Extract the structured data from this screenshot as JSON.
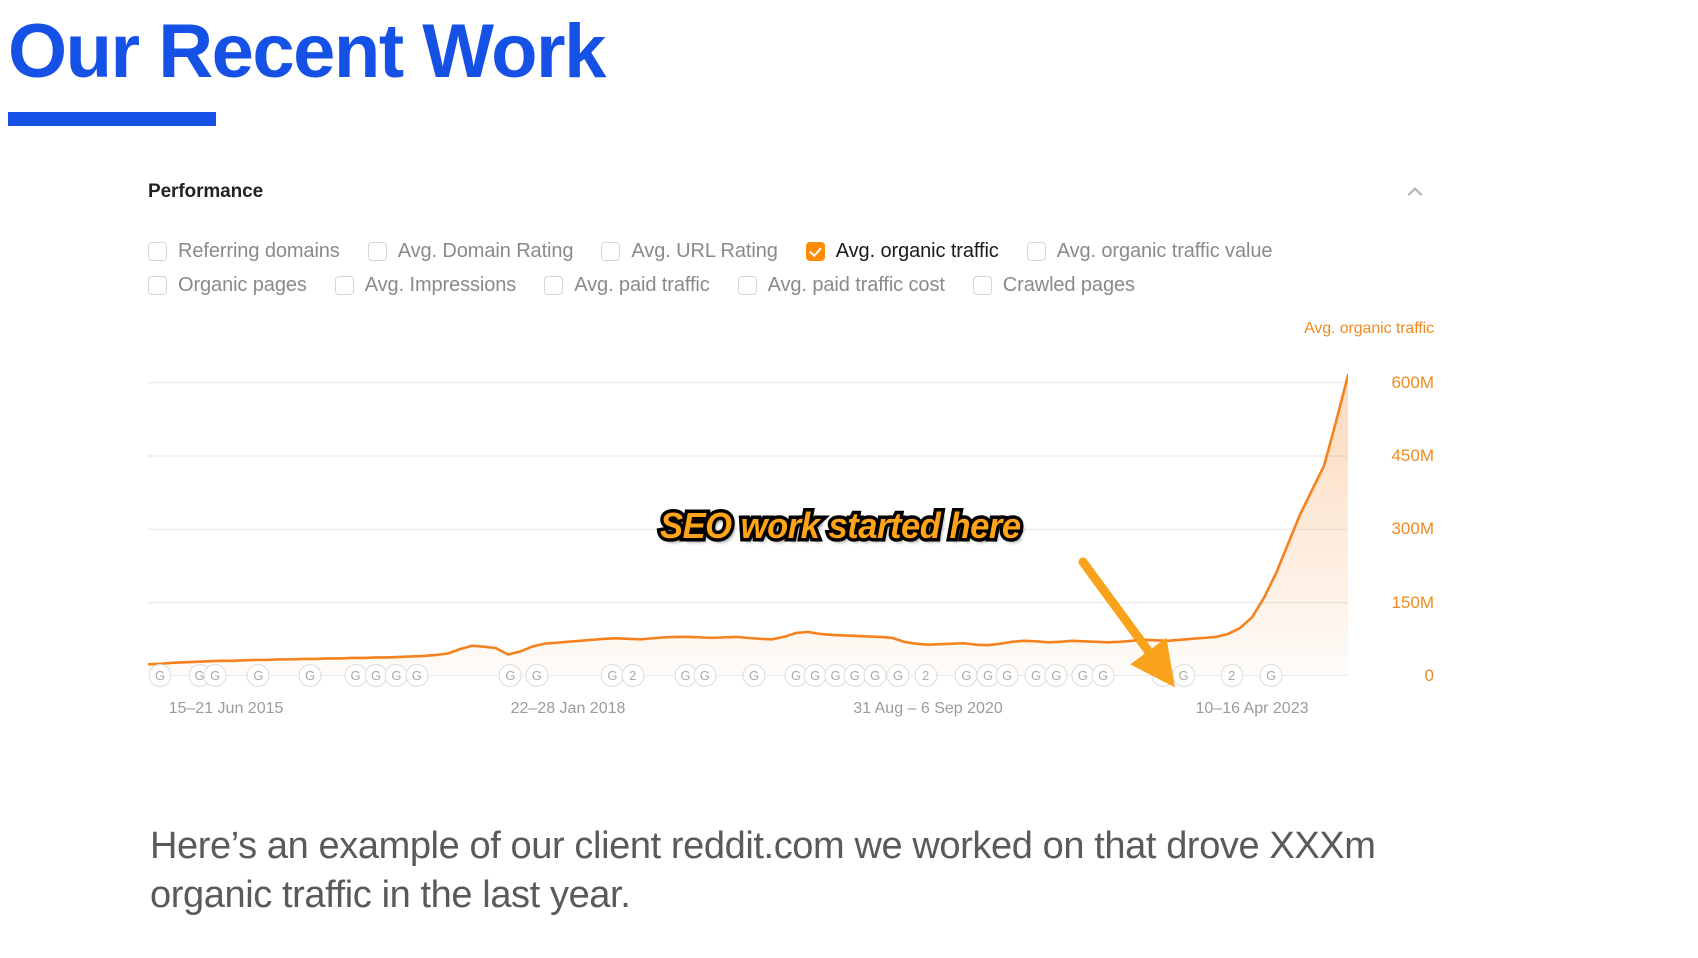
{
  "slide": {
    "title": "Our Recent Work",
    "accent_color": "#1551e5",
    "caption": "Here’s an example of our client reddit.com we worked on that drove XXXm organic traffic in the last year."
  },
  "panel": {
    "title": "Performance",
    "collapse_icon": "chevron-up-icon"
  },
  "metrics": {
    "row1": [
      {
        "label": "Referring domains",
        "checked": false
      },
      {
        "label": "Avg. Domain Rating",
        "checked": false
      },
      {
        "label": "Avg. URL Rating",
        "checked": false
      },
      {
        "label": "Avg. organic traffic",
        "checked": true
      },
      {
        "label": "Avg. organic traffic value",
        "checked": false
      }
    ],
    "row2": [
      {
        "label": "Organic pages",
        "checked": false
      },
      {
        "label": "Avg. Impressions",
        "checked": false
      },
      {
        "label": "Avg. paid traffic",
        "checked": false
      },
      {
        "label": "Avg. paid traffic cost",
        "checked": false
      },
      {
        "label": "Crawled pages",
        "checked": false
      }
    ]
  },
  "annotation": {
    "text": "SEO work started here",
    "text_color": "#ffa318",
    "outline_color": "#000000",
    "arrow_color": "#f9a21b"
  },
  "chart_data": {
    "type": "area",
    "title": "",
    "series_name": "Avg. organic traffic",
    "series_color": "#f5821f",
    "xlabel": "",
    "ylabel": "Avg. organic traffic",
    "ylim": [
      0,
      675
    ],
    "yticks": [
      0,
      150,
      300,
      450,
      600
    ],
    "ytick_labels": [
      "0",
      "150M",
      "300M",
      "450M",
      "600M"
    ],
    "value_unit": "millions",
    "grid": true,
    "legend_position": "top-right",
    "xtick_labels": [
      "15–21 Jun 2015",
      "22–28 Jan 2018",
      "31 Aug – 6 Sep 2020",
      "10–16 Apr 2023"
    ],
    "xtick_positions_pct": [
      6.5,
      35.0,
      65.0,
      92.0
    ],
    "algorithm_update_markers": [
      {
        "label": "G",
        "pos_pct": 1.0
      },
      {
        "label": "G",
        "pos_pct": 4.3
      },
      {
        "label": "G",
        "pos_pct": 5.6
      },
      {
        "label": "G",
        "pos_pct": 9.2
      },
      {
        "label": "G",
        "pos_pct": 13.5
      },
      {
        "label": "G",
        "pos_pct": 17.3
      },
      {
        "label": "G",
        "pos_pct": 19.0
      },
      {
        "label": "G",
        "pos_pct": 20.7
      },
      {
        "label": "G",
        "pos_pct": 22.4
      },
      {
        "label": "G",
        "pos_pct": 30.2
      },
      {
        "label": "G",
        "pos_pct": 32.4
      },
      {
        "label": "G",
        "pos_pct": 38.7
      },
      {
        "label": "2",
        "pos_pct": 40.4
      },
      {
        "label": "G",
        "pos_pct": 44.8
      },
      {
        "label": "G",
        "pos_pct": 46.4
      },
      {
        "label": "G",
        "pos_pct": 50.5
      },
      {
        "label": "G",
        "pos_pct": 54.0
      },
      {
        "label": "G",
        "pos_pct": 55.6
      },
      {
        "label": "G",
        "pos_pct": 57.3
      },
      {
        "label": "G",
        "pos_pct": 58.9
      },
      {
        "label": "G",
        "pos_pct": 60.6
      },
      {
        "label": "G",
        "pos_pct": 62.5
      },
      {
        "label": "2",
        "pos_pct": 64.8
      },
      {
        "label": "G",
        "pos_pct": 68.2
      },
      {
        "label": "G",
        "pos_pct": 70.0
      },
      {
        "label": "G",
        "pos_pct": 71.6
      },
      {
        "label": "G",
        "pos_pct": 74.0
      },
      {
        "label": "G",
        "pos_pct": 75.7
      },
      {
        "label": "G",
        "pos_pct": 77.9
      },
      {
        "label": "G",
        "pos_pct": 79.6
      },
      {
        "label": "G",
        "pos_pct": 84.6
      },
      {
        "label": "G",
        "pos_pct": 86.3
      },
      {
        "label": "2",
        "pos_pct": 90.3
      },
      {
        "label": "G",
        "pos_pct": 93.6
      }
    ],
    "x": [
      0,
      1,
      2,
      3,
      4,
      5,
      6,
      7,
      8,
      9,
      10,
      11,
      12,
      13,
      14,
      15,
      16,
      17,
      18,
      19,
      20,
      21,
      22,
      23,
      24,
      25,
      26,
      27,
      28,
      29,
      30,
      31,
      32,
      33,
      34,
      35,
      36,
      37,
      38,
      39,
      40,
      41,
      42,
      43,
      44,
      45,
      46,
      47,
      48,
      49,
      50,
      51,
      52,
      53,
      54,
      55,
      56,
      57,
      58,
      59,
      60,
      61,
      62,
      63,
      64,
      65,
      66,
      67,
      68,
      69,
      70,
      71,
      72,
      73,
      74,
      75,
      76,
      77,
      78,
      79,
      80,
      81,
      82,
      83,
      84,
      85,
      86,
      87,
      88,
      89,
      90,
      91,
      92,
      93,
      94,
      95,
      96,
      97,
      98,
      99,
      100
    ],
    "values": [
      24,
      25,
      27,
      28,
      29,
      30,
      31,
      31,
      32,
      33,
      33,
      34,
      34,
      35,
      35,
      36,
      36,
      37,
      37,
      38,
      38,
      39,
      40,
      41,
      43,
      46,
      55,
      62,
      60,
      57,
      44,
      50,
      60,
      66,
      68,
      70,
      72,
      74,
      76,
      77,
      76,
      75,
      77,
      79,
      80,
      80,
      79,
      78,
      79,
      80,
      78,
      76,
      75,
      80,
      88,
      90,
      86,
      84,
      83,
      82,
      81,
      80,
      78,
      70,
      66,
      64,
      65,
      66,
      67,
      64,
      63,
      66,
      70,
      72,
      71,
      69,
      70,
      72,
      71,
      70,
      69,
      70,
      72,
      74,
      73,
      72,
      74,
      76,
      78,
      80,
      86,
      98,
      120,
      160,
      210,
      270,
      330,
      380,
      430,
      520,
      615
    ],
    "annotation_point": {
      "x_pct": 78,
      "value": 80,
      "label": "SEO work started here"
    },
    "notes": "Traffic flat near 60–90M from mid-2015 through early 2023, then rises steeply to ~620M at the right edge."
  }
}
